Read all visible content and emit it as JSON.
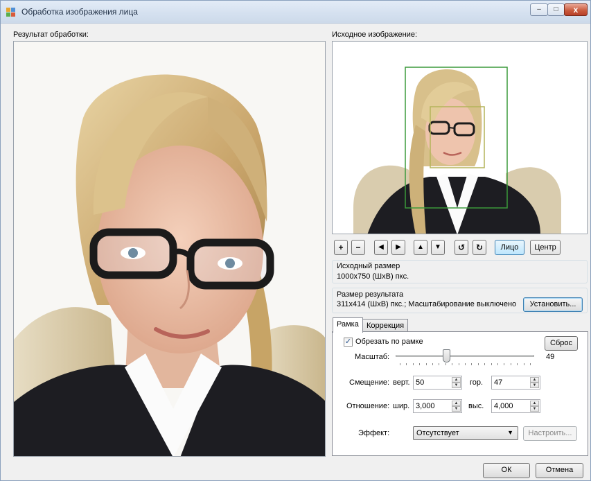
{
  "window": {
    "title": "Обработка изображения лица",
    "minimize_glyph": "‒",
    "maximize_glyph": "□",
    "close_glyph": "x"
  },
  "left": {
    "label": "Результат обработки:"
  },
  "source": {
    "label": "Исходное изображение:"
  },
  "toolbar": {
    "zoom_in": "+",
    "zoom_out": "−",
    "left": "◀",
    "right": "▶",
    "up": "▲",
    "down": "▼",
    "rotate_ccw": "↺",
    "rotate_cw": "↻",
    "face": "Лицо",
    "center": "Центр"
  },
  "orig_size": {
    "title": "Исходный размер",
    "value": "1000x750 (ШxВ) пкс."
  },
  "result_size": {
    "title": "Размер результата",
    "value": "311x414 (ШxВ) пкс.; Масштабирование выключено",
    "set_button": "Установить..."
  },
  "tabs": [
    {
      "label": "Рамка"
    },
    {
      "label": "Коррекция"
    }
  ],
  "frame_tab": {
    "crop_label": "Обрезать по рамке",
    "crop_checked": true,
    "reset_button": "Сброс",
    "scale_label": "Масштаб:",
    "scale_value": "49",
    "scale_level": 49,
    "offset_label": "Смещение:",
    "vert_label": "верт.",
    "vert_value": "50",
    "hor_label": "гор.",
    "hor_value": "47",
    "ratio_label": "Отношение:",
    "width_label": "шир.",
    "width_value": "3,000",
    "height_label": "выс.",
    "height_value": "4,000",
    "effect_label": "Эффект:",
    "effect_value": "Отсутствует",
    "configure_button": "Настроить..."
  },
  "footer": {
    "ok": "ОК",
    "cancel": "Отмена"
  },
  "colors": {
    "face_box": "#b4b45a",
    "frame_box": "#3b9a3b",
    "accent": "#3c7fb1"
  }
}
